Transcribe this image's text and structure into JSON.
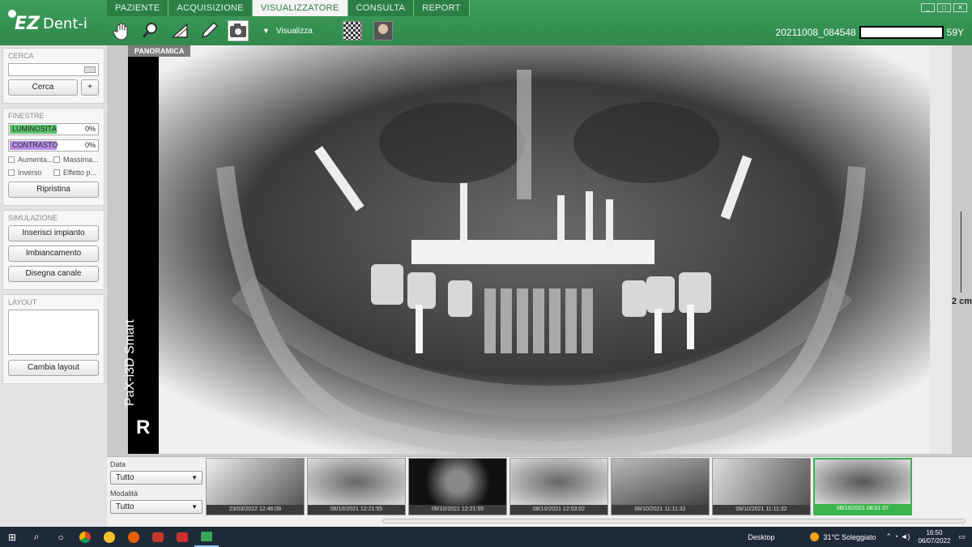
{
  "app": {
    "logo_ez": "EZ",
    "logo_dent": "Dent-i"
  },
  "tabs": [
    {
      "label": "PAZIENTE"
    },
    {
      "label": "ACQUISIZIONE"
    },
    {
      "label": "VISUALIZZATORE"
    },
    {
      "label": "CONSULTA"
    },
    {
      "label": "REPORT"
    }
  ],
  "toolbar": {
    "tools": [
      "hand-icon",
      "magnifier-icon",
      "angle-icon",
      "pencil-icon",
      "camera-icon"
    ],
    "visualizza_label": "Visualizza",
    "thumb_buttons": [
      "checker-icon",
      "face-icon"
    ]
  },
  "patient": {
    "id": "20211008_084548",
    "age": "59Y"
  },
  "sidebar": {
    "cerca": {
      "title": "CERCA",
      "search_placeholder": "",
      "button": "Cerca",
      "plus": "+"
    },
    "finestre": {
      "title": "FINESTRE",
      "luminosita": {
        "label": "LUMINOSITÀ",
        "value": "0%",
        "color": "#5cc46e"
      },
      "contrasto": {
        "label": "CONTRASTO",
        "value": "0%",
        "color": "#b68ee6"
      },
      "options": [
        "Aumenta...",
        "Massima...",
        "Inverso",
        "Effetto p..."
      ],
      "reset": "Ripristina"
    },
    "simulazione": {
      "title": "SIMULAZIONE",
      "buttons": [
        "Inserisci impianto",
        "Imbiancamento",
        "Disegna canale"
      ]
    },
    "layout": {
      "title": "LAYOUT",
      "button": "Cambia layout"
    }
  },
  "viewer": {
    "view_label": "PANORAMICA",
    "device_label": "PaX-i3D Smart",
    "side_marker": "R",
    "scale_label": "2 cm"
  },
  "filters": {
    "data_label": "Data",
    "data_value": "Tutto",
    "modalita_label": "Modalità",
    "modalita_value": "Tutto"
  },
  "thumbnails": [
    {
      "date": "23/03/2022 12:46:08",
      "selected": false
    },
    {
      "date": "08/10/2021 12:21:55",
      "selected": false
    },
    {
      "date": "08/10/2021 12:21:55",
      "selected": false
    },
    {
      "date": "08/10/2021 12:03:02",
      "selected": false
    },
    {
      "date": "08/10/2021 11:11:32",
      "selected": false
    },
    {
      "date": "08/10/2021 11:11:32",
      "selected": false
    },
    {
      "date": "08/10/2021 08:51:07",
      "selected": true
    }
  ],
  "taskbar": {
    "desktop_label": "Desktop",
    "weather": "31°C Soleggiato",
    "time": "16:50",
    "date": "06/07/2022"
  }
}
